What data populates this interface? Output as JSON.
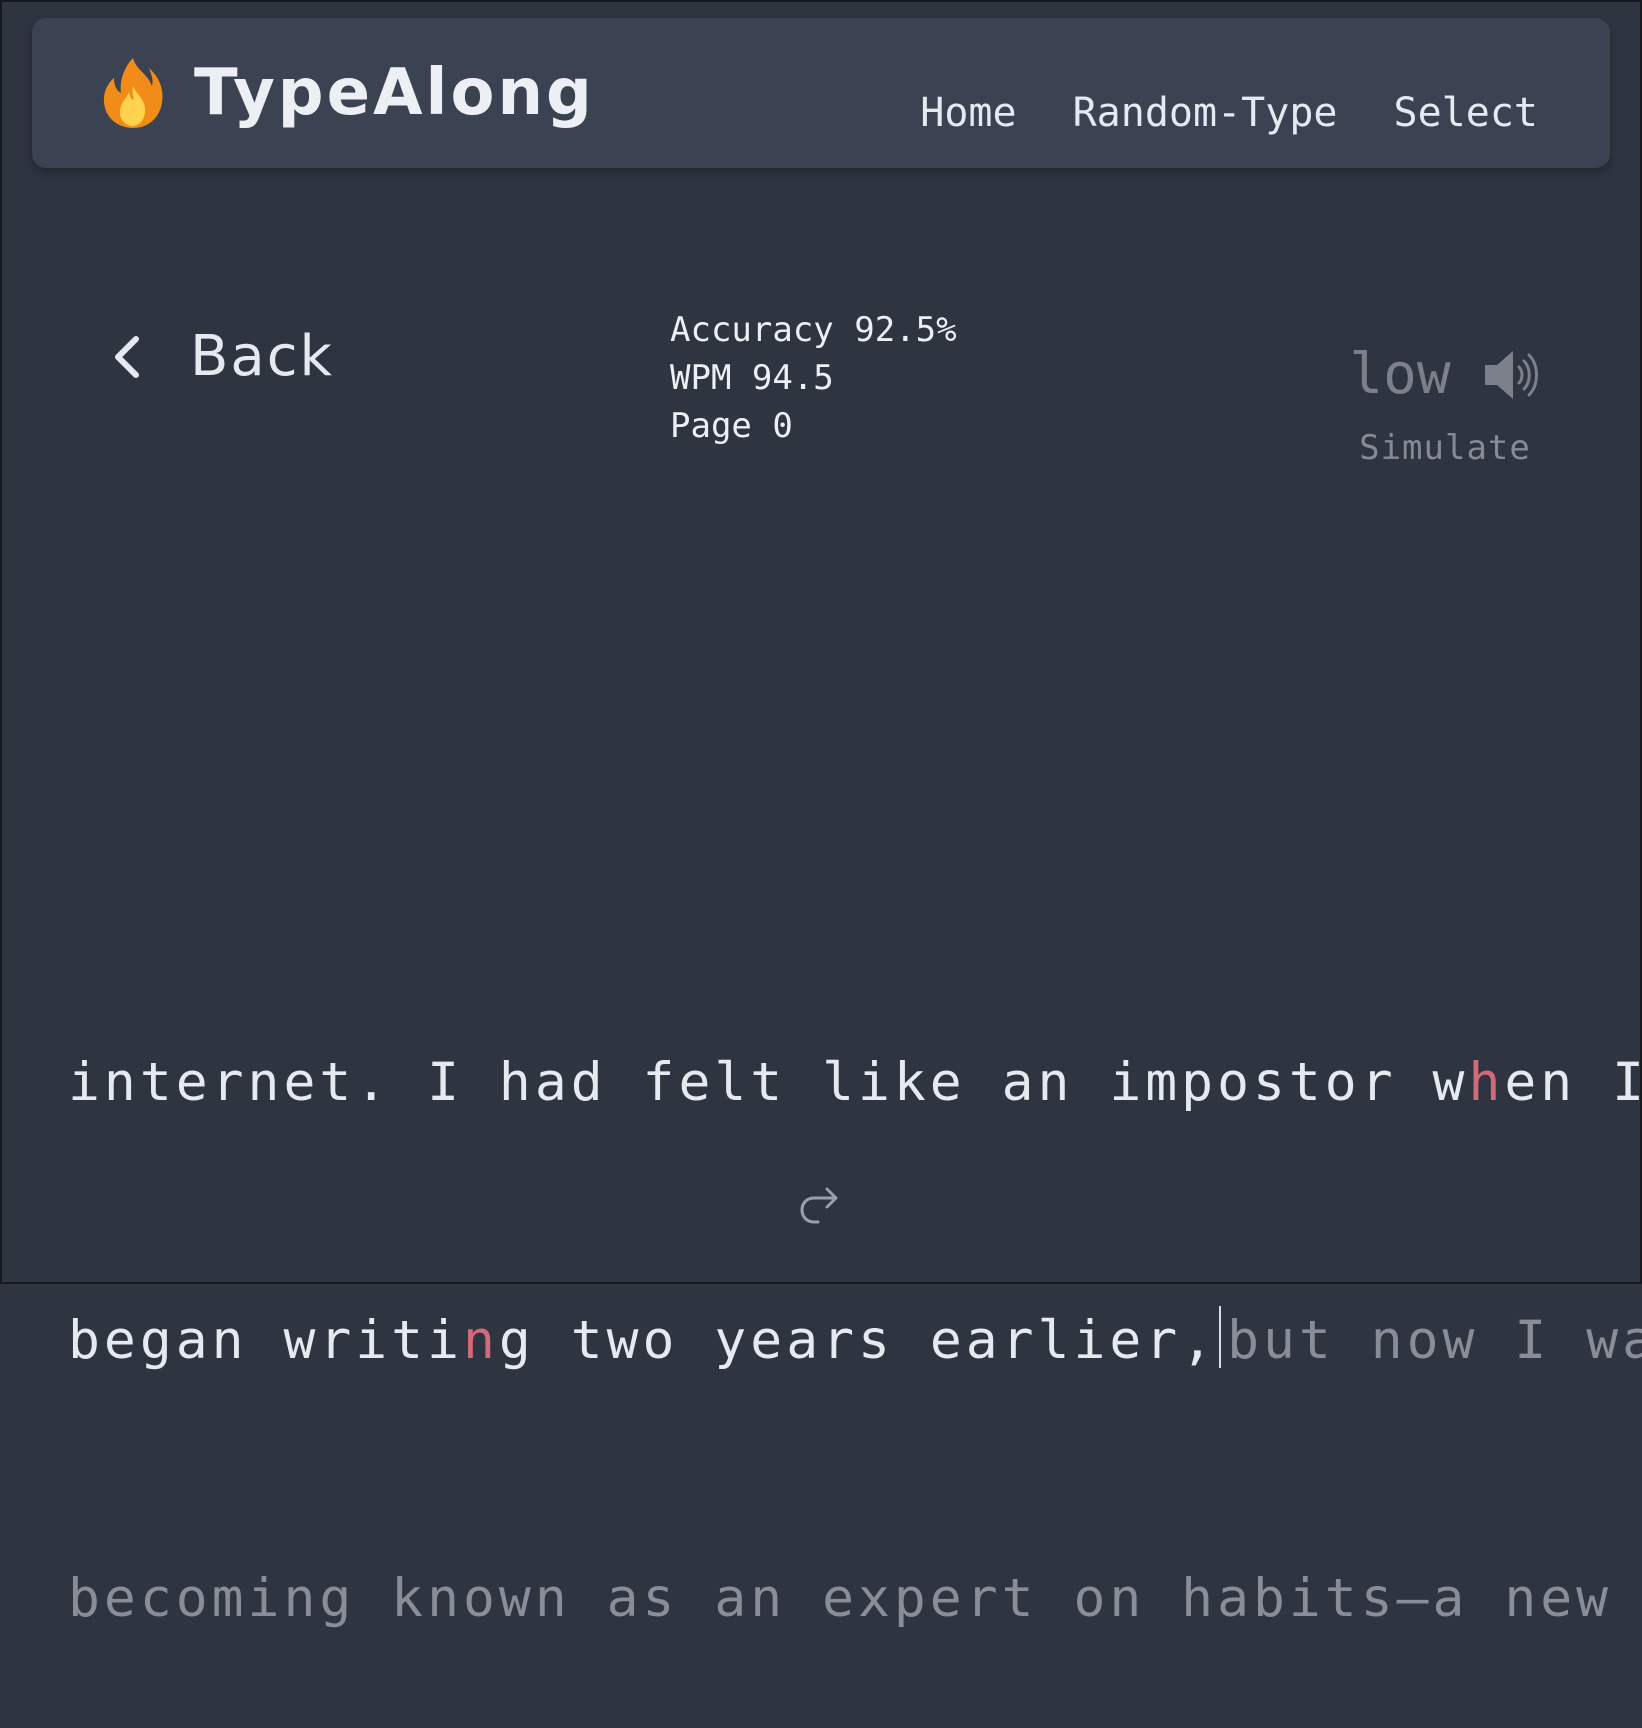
{
  "navbar": {
    "brand": "TypeAlong",
    "brand_icon": "flame-icon",
    "links": [
      "Home",
      "Random-Type",
      "Select"
    ]
  },
  "back": {
    "label": "Back",
    "icon": "chevron-left-icon"
  },
  "stats": {
    "accuracy": "Accuracy 92.5%",
    "wpm": "WPM 94.5",
    "page": "Page 0"
  },
  "sound": {
    "level": "low",
    "icon": "speaker-icon",
    "simulate_label": "Simulate"
  },
  "typing": {
    "line1_typed_a": "internet. I had felt like an impostor w",
    "line1_error": "h",
    "line1_typed_b": "en I",
    "line2_typed_a": "began writi",
    "line2_error": "n",
    "line2_typed_b": "g two years earlier,",
    "line2_untyped": "but now I was",
    "line3_untyped": "becoming known as an expert on habits—a new"
  },
  "next": {
    "icon": "redo-arrow-icon"
  },
  "colors": {
    "background": "#2e3440",
    "navbar": "#3b4252",
    "typed_text": "#e5e9f0",
    "error_text": "#d26a7a",
    "untyped_text": "#888d97"
  }
}
